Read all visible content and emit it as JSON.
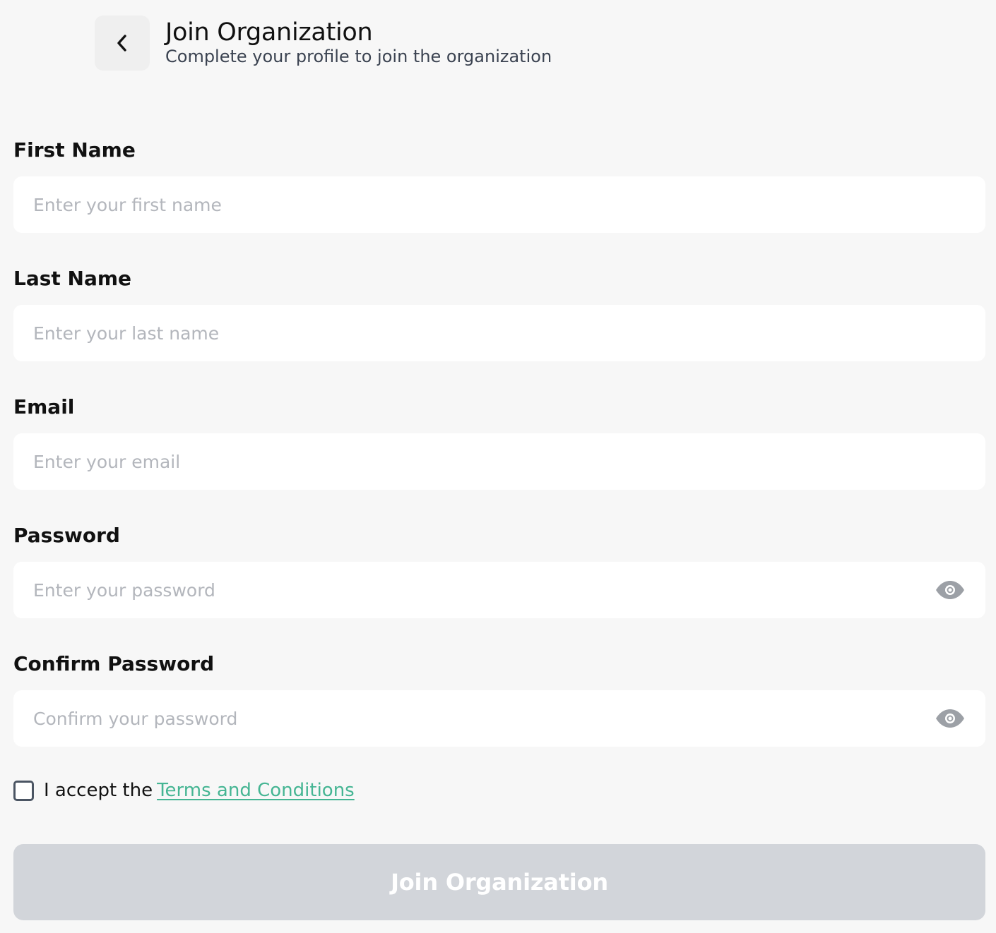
{
  "header": {
    "title": "Join Organization",
    "subtitle": "Complete your profile to join the organization",
    "back_icon": "chevron-left-icon"
  },
  "form": {
    "first_name": {
      "label": "First Name",
      "placeholder": "Enter your first name",
      "value": ""
    },
    "last_name": {
      "label": "Last Name",
      "placeholder": "Enter your last name",
      "value": ""
    },
    "email": {
      "label": "Email",
      "placeholder": "Enter your email",
      "value": ""
    },
    "password": {
      "label": "Password",
      "placeholder": "Enter your password",
      "value": "",
      "toggle_icon": "eye-icon"
    },
    "confirm_password": {
      "label": "Confirm Password",
      "placeholder": "Confirm your password",
      "value": "",
      "toggle_icon": "eye-icon"
    }
  },
  "terms": {
    "checked": false,
    "prefix": "I accept the",
    "link_text": "Terms and Conditions"
  },
  "submit": {
    "label": "Join Organization",
    "disabled": true
  },
  "colors": {
    "background": "#f7f7f7",
    "input_background": "#ffffff",
    "placeholder": "#b3b6bc",
    "link": "#45b593",
    "button_disabled": "#d2d5da",
    "icon_muted": "#9ca0a6"
  }
}
